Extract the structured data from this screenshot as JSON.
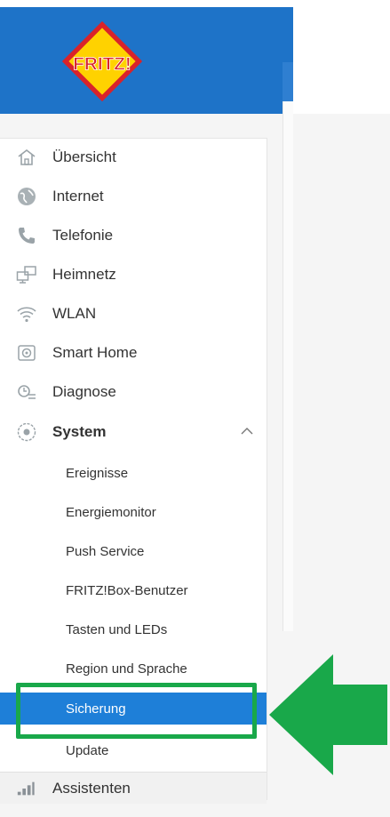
{
  "brand": {
    "logo_text": "FRITZ!"
  },
  "colors": {
    "header": "#1e73c8",
    "active": "#1e7fd8",
    "highlight": "#19a84a"
  },
  "nav": {
    "items": [
      {
        "label": "Übersicht",
        "icon": "home-icon"
      },
      {
        "label": "Internet",
        "icon": "globe-icon"
      },
      {
        "label": "Telefonie",
        "icon": "phone-icon"
      },
      {
        "label": "Heimnetz",
        "icon": "network-icon"
      },
      {
        "label": "WLAN",
        "icon": "wifi-icon"
      },
      {
        "label": "Smart Home",
        "icon": "smart-home-icon"
      },
      {
        "label": "Diagnose",
        "icon": "diagnose-icon"
      },
      {
        "label": "System",
        "icon": "system-icon",
        "expanded": true
      }
    ],
    "system_sub": [
      {
        "label": "Ereignisse"
      },
      {
        "label": "Energiemonitor"
      },
      {
        "label": "Push Service"
      },
      {
        "label": "FRITZ!Box-Benutzer"
      },
      {
        "label": "Tasten und LEDs"
      },
      {
        "label": "Region und Sprache"
      },
      {
        "label": "Sicherung",
        "active": true
      },
      {
        "label": "Update"
      }
    ],
    "assistant": {
      "label": "Assistenten",
      "icon": "assistant-icon"
    }
  }
}
